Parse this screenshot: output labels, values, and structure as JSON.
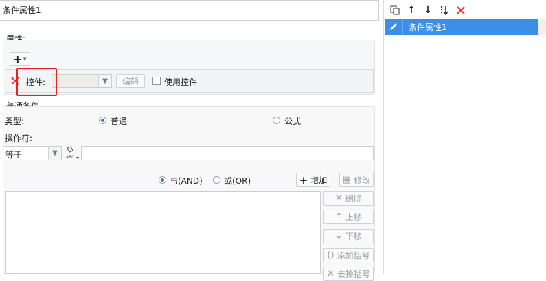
{
  "condition_name": "条件属性1",
  "attributes": {
    "label": "属性:",
    "control_label": "控件:",
    "control_value": "",
    "edit_button": "编辑",
    "use_control_label": "使用控件"
  },
  "normal_condition": {
    "label": "普通条件",
    "type_label": "类型:",
    "type_normal": "普通",
    "type_formula": "公式",
    "operator_label": "操作符:",
    "operator_value": "等于",
    "value_text": ""
  },
  "logic": {
    "and_label": "与(AND)",
    "or_label": "或(OR)",
    "add_button": "增加",
    "modify_button": "修改",
    "selected": "and"
  },
  "side_buttons": {
    "delete": "删除",
    "move_up": "上移",
    "move_down": "下移",
    "add_bracket": "添加括号",
    "remove_bracket": "去掉括号"
  },
  "conditions_list": [
    {
      "name": "条件属性1",
      "selected": true
    }
  ],
  "colors": {
    "accent": "#3d8ee6",
    "highlight_border": "#e02424",
    "delete_red": "#e53935"
  }
}
